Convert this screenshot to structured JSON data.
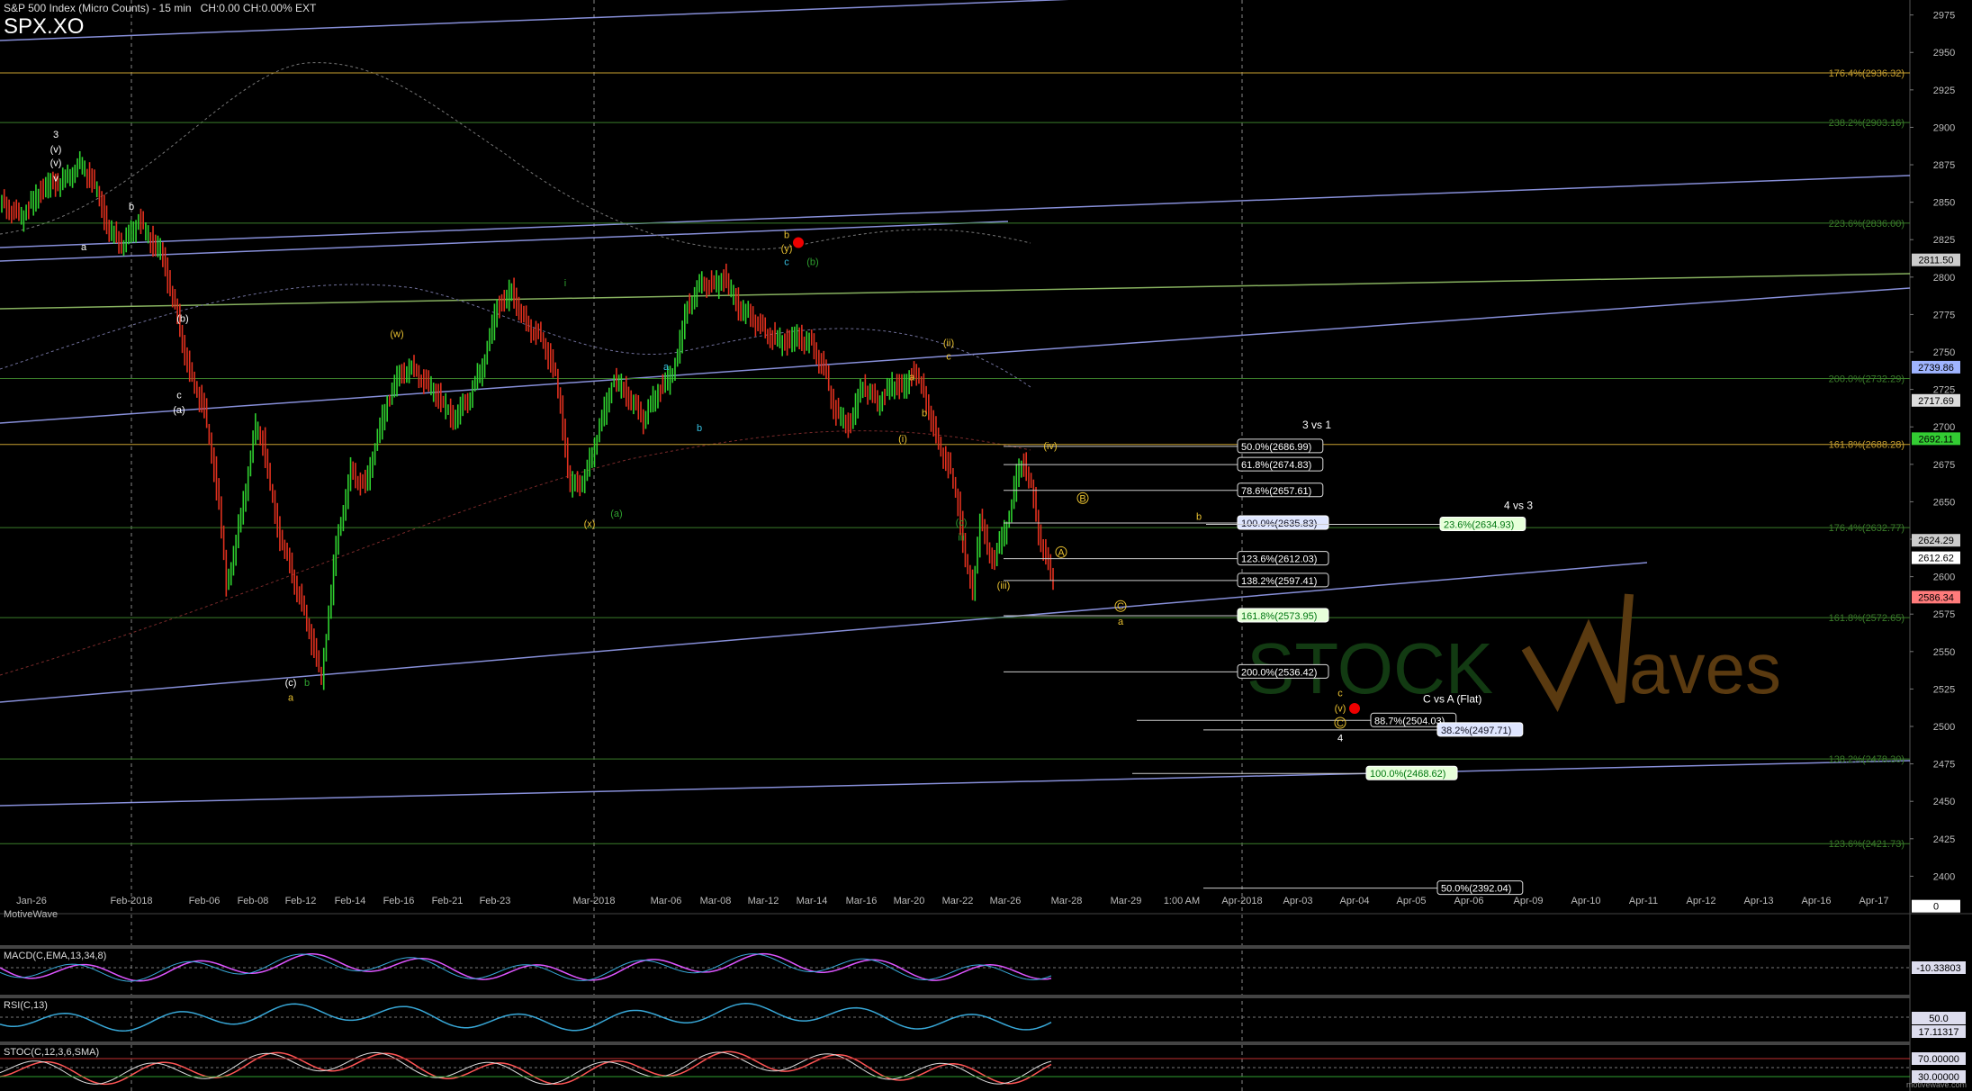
{
  "header": {
    "title": "S&P 500 Index (Micro Counts) - 15 min",
    "stats": "CH:0.00  CH:0.00%  EXT",
    "symbol": "SPX.XO"
  },
  "branding": {
    "watermark_left": "STOCK",
    "watermark_right": "aves",
    "chart_credit": "MotiveWave",
    "footer": "motivewave.com"
  },
  "colors": {
    "up": "#2fd12f",
    "down": "#e0301e",
    "price_line": "#e8b83a",
    "trend": "#9fa8ff"
  },
  "chart_data": {
    "type": "line",
    "title": "",
    "ylim": [
      2375,
      2985
    ],
    "x_tick_labels": [
      "Jan-26",
      "Feb-2018",
      "Feb-06",
      "Feb-08",
      "Feb-12",
      "Feb-14",
      "Feb-16",
      "Feb-21",
      "Feb-23",
      "Mar-2018",
      "Mar-06",
      "Mar-08",
      "Mar-12",
      "Mar-14",
      "Mar-16",
      "Mar-20",
      "Mar-22",
      "Mar-26",
      "Mar-28",
      "Mar-29",
      "1:00 AM",
      "Apr-2018",
      "Apr-03",
      "Apr-04",
      "Apr-05",
      "Apr-06",
      "Apr-09",
      "Apr-10",
      "Apr-11",
      "Apr-12",
      "Apr-13",
      "Apr-16",
      "Apr-17"
    ],
    "y_ticks": [
      2400,
      2425,
      2450,
      2475,
      2500,
      2525,
      2550,
      2575,
      2600,
      2625,
      2650,
      2675,
      2700,
      2725,
      2750,
      2775,
      2800,
      2825,
      2850,
      2875,
      2900,
      2925,
      2950,
      2975
    ],
    "price_path": [
      [
        0,
        2850
      ],
      [
        3,
        2840
      ],
      [
        6,
        2860
      ],
      [
        9,
        2865
      ],
      [
        11,
        2875
      ],
      [
        13,
        2862
      ],
      [
        15,
        2830
      ],
      [
        17,
        2822
      ],
      [
        19,
        2838
      ],
      [
        21,
        2822
      ],
      [
        22,
        2818
      ],
      [
        24,
        2780
      ],
      [
        26,
        2735
      ],
      [
        28,
        2712
      ],
      [
        30,
        2650
      ],
      [
        31,
        2592
      ],
      [
        33,
        2640
      ],
      [
        35,
        2700
      ],
      [
        36,
        2690
      ],
      [
        38,
        2632
      ],
      [
        40,
        2602
      ],
      [
        42,
        2570
      ],
      [
        44,
        2532
      ],
      [
        46,
        2620
      ],
      [
        48,
        2670
      ],
      [
        50,
        2660
      ],
      [
        52,
        2700
      ],
      [
        54,
        2730
      ],
      [
        56,
        2740
      ],
      [
        58,
        2731
      ],
      [
        60,
        2720
      ],
      [
        62,
        2705
      ],
      [
        64,
        2718
      ],
      [
        66,
        2740
      ],
      [
        68,
        2780
      ],
      [
        70,
        2790
      ],
      [
        72,
        2768
      ],
      [
        74,
        2760
      ],
      [
        76,
        2735
      ],
      [
        77,
        2700
      ],
      [
        78,
        2660
      ],
      [
        80,
        2665
      ],
      [
        82,
        2700
      ],
      [
        84,
        2732
      ],
      [
        86,
        2720
      ],
      [
        88,
        2705
      ],
      [
        90,
        2724
      ],
      [
        92,
        2735
      ],
      [
        94,
        2780
      ],
      [
        96,
        2796
      ],
      [
        98,
        2795
      ],
      [
        99,
        2800
      ],
      [
        101,
        2780
      ],
      [
        103,
        2772
      ],
      [
        105,
        2762
      ],
      [
        107,
        2756
      ],
      [
        109,
        2760
      ],
      [
        111,
        2755
      ],
      [
        113,
        2735
      ],
      [
        114,
        2712
      ],
      [
        116,
        2700
      ],
      [
        118,
        2728
      ],
      [
        120,
        2716
      ],
      [
        122,
        2728
      ],
      [
        124,
        2727
      ],
      [
        125,
        2740
      ],
      [
        127,
        2712
      ],
      [
        128,
        2692
      ],
      [
        130,
        2670
      ],
      [
        131,
        2648
      ],
      [
        132,
        2612
      ],
      [
        133,
        2588
      ],
      [
        134,
        2640
      ],
      [
        135,
        2618
      ],
      [
        136,
        2612
      ],
      [
        138,
        2640
      ],
      [
        139,
        2668
      ],
      [
        140,
        2676
      ],
      [
        141,
        2660
      ],
      [
        142,
        2630
      ],
      [
        143,
        2612
      ],
      [
        144,
        2597
      ]
    ],
    "horizontal_levels": [
      {
        "price": 2936.32,
        "label": "176.4%(2936.32)",
        "color": "#c8a030"
      },
      {
        "price": 2903.16,
        "label": "238.2%(2903.16)",
        "color": "#3a7d2a"
      },
      {
        "price": 2836.0,
        "label": "223.6%(2836.00)",
        "color": "#3a7d2a"
      },
      {
        "price": 2732.29,
        "label": "200.0%(2732.29)",
        "color": "#3a7d2a"
      },
      {
        "price": 2688.28,
        "label": "161.8%(2688.28)",
        "color": "#c8a030"
      },
      {
        "price": 2632.77,
        "label": "176.4%(2632.77)",
        "color": "#3a7d2a"
      },
      {
        "price": 2572.65,
        "label": "161.8%(2572.65)",
        "color": "#3a7d2a"
      },
      {
        "price": 2478.3,
        "label": "138.2%(2478.30)",
        "color": "#3a7d2a"
      },
      {
        "price": 2421.73,
        "label": "123.6%(2421.73)",
        "color": "#3a7d2a"
      }
    ],
    "fib_boxes": [
      {
        "label": "50.0%(2686.99)",
        "price": 2686.99,
        "x": 1375,
        "style": "w"
      },
      {
        "label": "61.8%(2674.83)",
        "price": 2674.83,
        "x": 1375,
        "style": "w"
      },
      {
        "label": "78.6%(2657.61)",
        "price": 2657.61,
        "x": 1375,
        "style": "w"
      },
      {
        "label": "100.0%(2635.83)",
        "price": 2635.83,
        "x": 1375,
        "style": "b"
      },
      {
        "label": "123.6%(2612.03)",
        "price": 2612.03,
        "x": 1375,
        "style": "w"
      },
      {
        "label": "138.2%(2597.41)",
        "price": 2597.41,
        "x": 1375,
        "style": "w"
      },
      {
        "label": "161.8%(2573.95)",
        "price": 2573.95,
        "x": 1375,
        "style": "g"
      },
      {
        "label": "200.0%(2536.42)",
        "price": 2536.42,
        "x": 1375,
        "style": "w"
      },
      {
        "label": "23.6%(2634.93)",
        "price": 2634.93,
        "x": 1600,
        "style": "g"
      },
      {
        "label": "88.7%(2504.03)",
        "price": 2504.03,
        "x": 1523,
        "style": "w"
      },
      {
        "label": "38.2%(2497.71)",
        "price": 2497.71,
        "x": 1597,
        "style": "b"
      },
      {
        "label": "100.0%(2468.62)",
        "price": 2468.62,
        "x": 1518,
        "style": "g"
      },
      {
        "label": "50.0%(2392.04)",
        "price": 2392.04,
        "x": 1597,
        "style": "w"
      }
    ],
    "section_labels": [
      {
        "text": "3 vs 1",
        "x": 1447,
        "price": 2699
      },
      {
        "text": "4 vs 3",
        "x": 1671,
        "price": 2645
      },
      {
        "text": "C vs A (Flat)",
        "x": 1581,
        "price": 2516
      }
    ],
    "price_tags": [
      {
        "label": "2811.50",
        "price": 2811.5,
        "color": "#cccccc"
      },
      {
        "label": "2739.86",
        "price": 2739.86,
        "color": "#9fb4ff"
      },
      {
        "label": "2717.69",
        "price": 2717.69,
        "color": "#dddddd"
      },
      {
        "label": "2692.11",
        "price": 2692.11,
        "color": "#33cc33"
      },
      {
        "label": "2624.29",
        "price": 2624.29,
        "color": "#cccccc"
      },
      {
        "label": "2612.62",
        "price": 2612.62,
        "color": "#ffffff"
      },
      {
        "label": "2586.34",
        "price": 2586.34,
        "color": "#ff7b7b"
      },
      {
        "label": "0",
        "price": 2380,
        "color": "#ffffff"
      }
    ],
    "wave_labels": [
      {
        "t": "3",
        "x": 62,
        "price": 2893,
        "c": "#fff"
      },
      {
        "t": "(v)",
        "x": 62,
        "price": 2883,
        "c": "#fff"
      },
      {
        "t": "(v)",
        "x": 62,
        "price": 2874,
        "c": "#fff"
      },
      {
        "t": "v",
        "x": 62,
        "price": 2864,
        "c": "#fff"
      },
      {
        "t": "a",
        "x": 93,
        "price": 2818,
        "c": "#fff"
      },
      {
        "t": "b",
        "x": 146,
        "price": 2845,
        "c": "#fff"
      },
      {
        "t": "(b)",
        "x": 203,
        "price": 2770,
        "c": "#fff"
      },
      {
        "t": "c",
        "x": 199,
        "price": 2719,
        "c": "#fff"
      },
      {
        "t": "(a)",
        "x": 199,
        "price": 2709,
        "c": "#fff"
      },
      {
        "t": "(c)",
        "x": 323,
        "price": 2527,
        "c": "#fff"
      },
      {
        "t": "a",
        "x": 323,
        "price": 2517,
        "c": "#e8c030"
      },
      {
        "t": "b",
        "x": 341,
        "price": 2527,
        "c": "#2fa02f"
      },
      {
        "t": "(w)",
        "x": 441,
        "price": 2760,
        "c": "#e8c030"
      },
      {
        "t": "i",
        "x": 628,
        "price": 2794,
        "c": "#2fa02f"
      },
      {
        "t": "(x)",
        "x": 655,
        "price": 2633,
        "c": "#e8c030"
      },
      {
        "t": "(a)",
        "x": 685,
        "price": 2640,
        "c": "#2fa02f"
      },
      {
        "t": "a",
        "x": 740,
        "price": 2738,
        "c": "#36c0e0"
      },
      {
        "t": "b",
        "x": 777,
        "price": 2697,
        "c": "#36c0e0"
      },
      {
        "t": "b",
        "x": 874,
        "price": 2826,
        "c": "#e8c030"
      },
      {
        "t": "(y)",
        "x": 874,
        "price": 2817,
        "c": "#e8c030"
      },
      {
        "t": "c",
        "x": 874,
        "price": 2808,
        "c": "#36c0e0"
      },
      {
        "t": "(b)",
        "x": 903,
        "price": 2808,
        "c": "#2fa02f"
      },
      {
        "t": "(ii)",
        "x": 1054,
        "price": 2754,
        "c": "#e8c030"
      },
      {
        "t": "c",
        "x": 1054,
        "price": 2745,
        "c": "#e8c030"
      },
      {
        "t": "a",
        "x": 1013,
        "price": 2731,
        "c": "#e8c030"
      },
      {
        "t": "b",
        "x": 1027,
        "price": 2707,
        "c": "#e8c030"
      },
      {
        "t": "(i)",
        "x": 1003,
        "price": 2690,
        "c": "#e8c030"
      },
      {
        "t": "(iv)",
        "x": 1167,
        "price": 2685,
        "c": "#e8c030"
      },
      {
        "t": "B",
        "x": 1203,
        "price": 2650,
        "c": "#e8c030"
      },
      {
        "t": "b",
        "x": 1332,
        "price": 2638,
        "c": "#e8c030"
      },
      {
        "t": "(c)",
        "x": 1068,
        "price": 2634,
        "c": "#2fa02f"
      },
      {
        "t": "iii",
        "x": 1068,
        "price": 2624,
        "c": "#2fa02f"
      },
      {
        "t": "A",
        "x": 1179,
        "price": 2614,
        "c": "#e8c030"
      },
      {
        "t": "(iii)",
        "x": 1115,
        "price": 2592,
        "c": "#e8c030"
      },
      {
        "t": "C",
        "x": 1245,
        "price": 2578,
        "c": "#e8c030"
      },
      {
        "t": "a",
        "x": 1245,
        "price": 2568,
        "c": "#e8c030"
      },
      {
        "t": "c",
        "x": 1489,
        "price": 2520,
        "c": "#e8c030"
      },
      {
        "t": "(v)",
        "x": 1489,
        "price": 2510,
        "c": "#e8c030"
      },
      {
        "t": "C",
        "x": 1489,
        "price": 2500,
        "c": "#e8c030"
      },
      {
        "t": "4",
        "x": 1489,
        "price": 2490,
        "c": "#fff"
      }
    ]
  },
  "indicators": {
    "macd": {
      "label": "MACD(C,EMA,13,34,8)",
      "value": "-10.33803",
      "zero": "0"
    },
    "rsi": {
      "label": "RSI(C,13)",
      "level": "50.0",
      "value": "17.11317"
    },
    "stoch": {
      "label": "STOC(C,12,3,6,SMA)",
      "upper": "70.00000",
      "lower": "30.00000"
    }
  }
}
